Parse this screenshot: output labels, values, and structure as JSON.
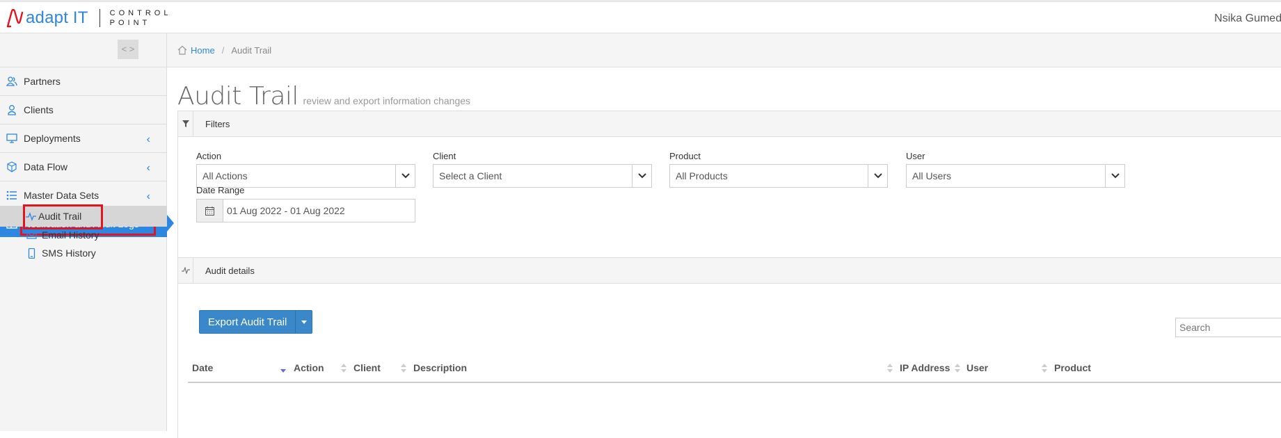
{
  "header": {
    "brand": "adapt IT",
    "product_line1": "CONTROL",
    "product_line2": "POINT",
    "username": "Nsika Gumede"
  },
  "sidebar": {
    "toggle": "< >",
    "items": [
      {
        "label": "Partners",
        "icon": "partners-icon"
      },
      {
        "label": "Clients",
        "icon": "client-icon"
      },
      {
        "label": "Deployments",
        "icon": "monitor-icon",
        "expandable": true
      },
      {
        "label": "Data Flow",
        "icon": "cube-icon",
        "expandable": true
      },
      {
        "label": "Master Data Sets",
        "icon": "list-icon",
        "expandable": true
      },
      {
        "label": "Notification and Audit Logs",
        "icon": "book-icon",
        "expanded": true,
        "active": true
      }
    ],
    "subitems": [
      {
        "label": "Audit Trail",
        "icon": "activity-icon",
        "selected": true
      },
      {
        "label": "Email History",
        "icon": "envelope-icon"
      },
      {
        "label": "SMS History",
        "icon": "mobile-icon"
      }
    ]
  },
  "breadcrumb": {
    "home": "Home",
    "current": "Audit Trail"
  },
  "page": {
    "title": "Audit Trail",
    "subtitle": "review and export information changes"
  },
  "filters": {
    "heading": "Filters",
    "action_label": "Action",
    "action_value": "All Actions",
    "client_label": "Client",
    "client_value": "Select a Client",
    "product_label": "Product",
    "product_value": "All Products",
    "user_label": "User",
    "user_value": "All Users",
    "date_label": "Date Range",
    "date_value": "01 Aug 2022 - 01 Aug 2022"
  },
  "audit": {
    "heading": "Audit details",
    "export_label": "Export Audit Trail",
    "search_placeholder": "Search",
    "columns": [
      "Date",
      "Action",
      "Client",
      "Description",
      "IP Address",
      "User",
      "Product"
    ]
  },
  "colors": {
    "accent": "#2d86e0",
    "highlight": "#e3141d",
    "export_button": "#3a87c9"
  }
}
